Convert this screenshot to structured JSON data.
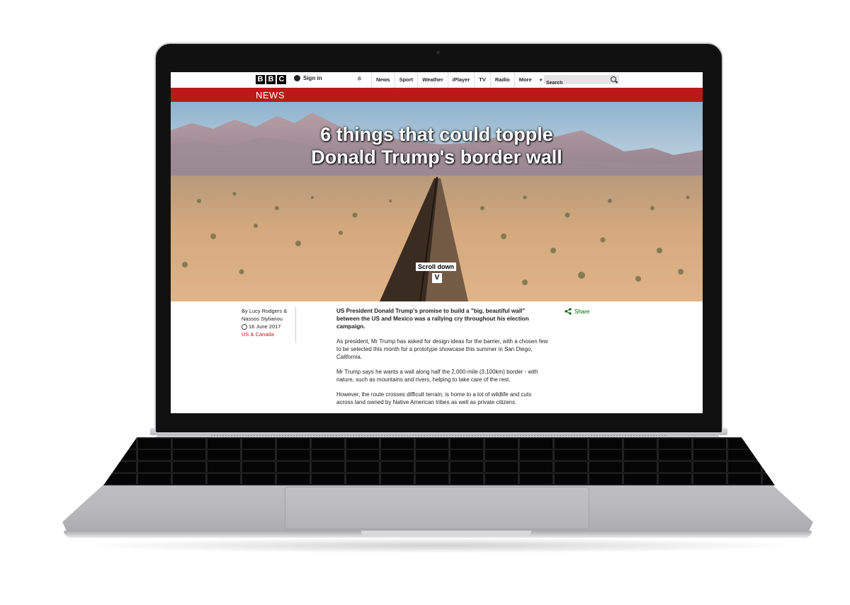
{
  "header": {
    "logo_letters": [
      "B",
      "B",
      "C"
    ],
    "sign_in": "Sign in",
    "nav": [
      "News",
      "Sport",
      "Weather",
      "iPlayer",
      "TV",
      "Radio"
    ],
    "more": "More",
    "search_placeholder": "Search"
  },
  "section_bar": {
    "label": "NEWS"
  },
  "hero": {
    "headline_line1": "6 things that could topple",
    "headline_line2": "Donald Trump's border wall",
    "scroll_label": "Scroll down",
    "scroll_arrow": "V"
  },
  "byline": {
    "authors_line1": "By Lucy Rodgers &",
    "authors_line2": "Nassos Stylianou",
    "date": "16 June 2017",
    "section": "US & Canada"
  },
  "article": {
    "paragraphs": [
      "US President Donald Trump's promise to build a \"big, beautiful wall\" between the US and Mexico was a rallying cry throughout his election campaign.",
      "As president, Mr Trump has asked for design ideas for the barrier, with a chosen few to be selected this month for a prototype showcase this summer in San Diego, California.",
      "Mr Trump says he wants a wall along half the 2,000-mile (3,100km) border - with nature, such as mountains and rivers, helping to take care of the rest.",
      "However, the route crosses difficult terrain, is home to a lot of wildlife and cuts across land owned by Native American tribes as well as private citizens."
    ]
  },
  "share": {
    "label": "Share"
  },
  "colors": {
    "bbc_red": "#bb1919",
    "share_green": "#006600"
  }
}
